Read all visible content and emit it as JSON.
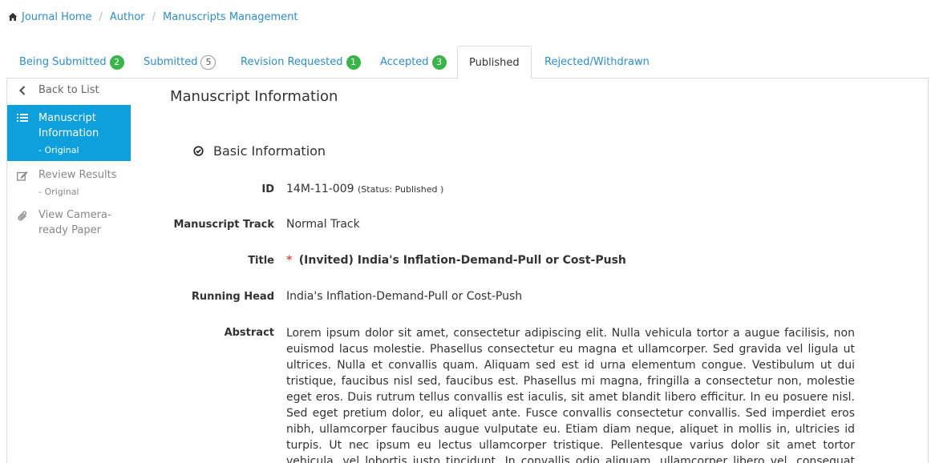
{
  "breadcrumb": [
    "Journal Home",
    "Author",
    "Manuscripts Management"
  ],
  "tabs": [
    {
      "label": "Being Submitted",
      "badge": "2",
      "badge_style": "green"
    },
    {
      "label": "Submitted",
      "badge": "5",
      "badge_style": "outline"
    },
    {
      "label": "Revision Requested",
      "badge": "1",
      "badge_style": "green"
    },
    {
      "label": "Accepted",
      "badge": "3",
      "badge_style": "green"
    },
    {
      "label": "Published",
      "active": true
    },
    {
      "label": "Rejected/Withdrawn"
    }
  ],
  "sidebar": {
    "back": "Back to List",
    "items": [
      {
        "label": "Manuscript Information",
        "sub": "- Original",
        "icon": "list-icon",
        "active": true
      },
      {
        "label": "Review Results",
        "sub": "- Original",
        "icon": "edit-icon"
      },
      {
        "label": "View Camera-ready Paper",
        "icon": "paperclip-icon"
      }
    ]
  },
  "main": {
    "title": "Manuscript Information",
    "section": "Basic Information",
    "fields": {
      "id_label": "ID",
      "id_value": "14M-11-009",
      "id_status": "(Status: Published )",
      "track_label": "Manuscript Track",
      "track_value": "Normal Track",
      "title_label": "Title",
      "title_required": "*",
      "title_value": "(Invited) India's Inflation-Demand-Pull or Cost-Push",
      "running_label": "Running Head",
      "running_value": "India's Inflation-Demand-Pull or Cost-Push",
      "abstract_label": "Abstract",
      "abstract_value": "Lorem ipsum dolor sit amet, consectetur adipiscing elit. Nulla vehicula tortor a augue facilisis, non euismod lacus molestie. Phasellus consectetur eu magna et ullamcorper. Sed gravida vel ligula ut ultrices. Nulla et convallis quam. Aliquam sed est id urna elementum congue. Vestibulum ut dui tristique, faucibus nisl sed, faucibus est. Phasellus mi magna, fringilla a consectetur non, molestie eget eros. Duis rutrum tellus convallis est iaculis, sit amet blandit libero efficitur. In eu posuere nisl. Sed eget pretium dolor, eu aliquet ante. Fusce convallis consectetur convallis. Sed imperdiet eros nibh, ullamcorper faucibus augue vulputate eu. Etiam diam neque, aliquet in mollis in, ultricies id turpis. Ut nec ipsum eu lectus ullamcorper tristique. Pellentesque varius dolor sit amet tortor vehicula, vel lobortis justo tincidunt. In convallis odio aliquam, ullamcorper libero vel, consequat sem. Aenean sollicitudin lectus non ullamcorper iaculis. Fusce vel justo risus. Sed congue"
    }
  },
  "colors": {
    "link": "#2a8ecf",
    "active_side": "#0e9fdd",
    "badge_green": "#3bb44a",
    "required": "#d9534f"
  }
}
